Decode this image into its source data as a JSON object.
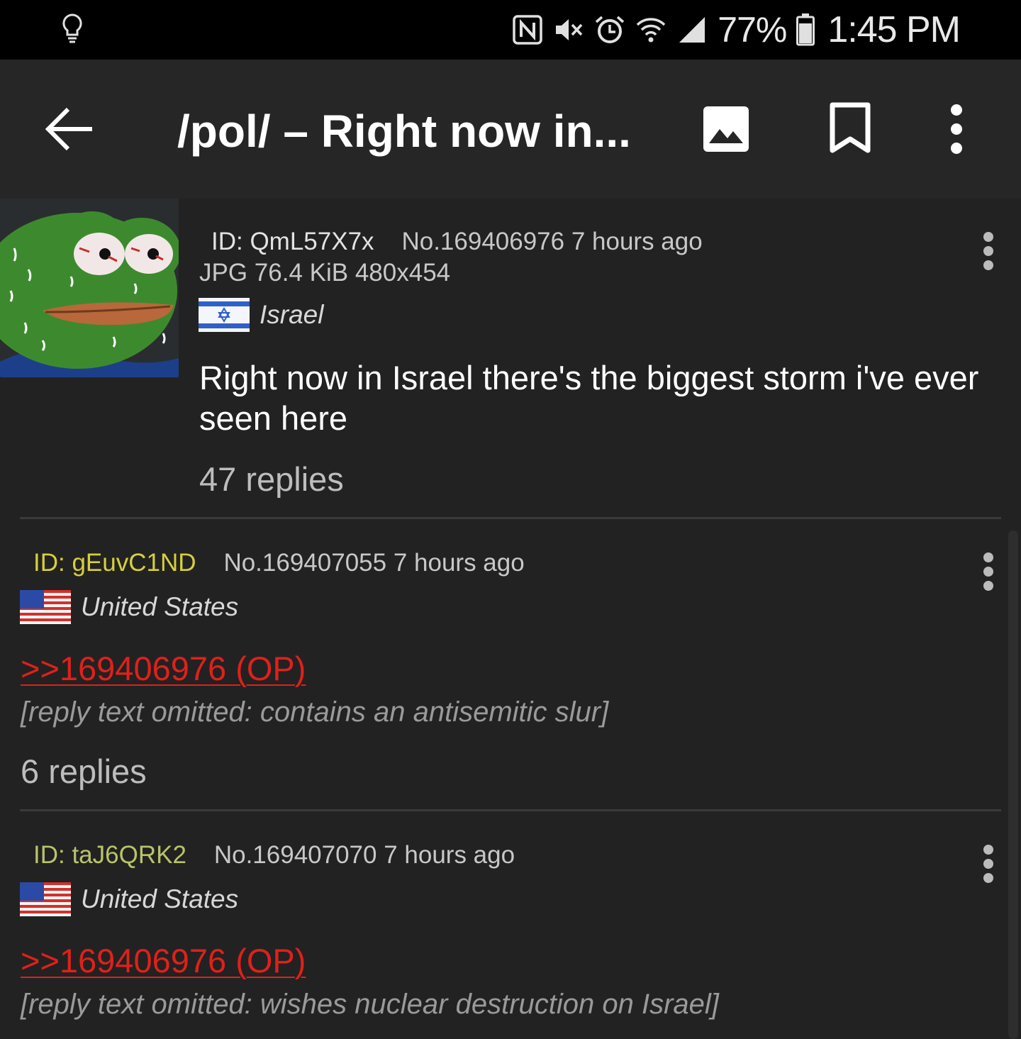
{
  "status_bar": {
    "battery_percent": "77%",
    "time": "1:45 PM",
    "icons": [
      "lightbulb-icon",
      "nfc-icon",
      "mute-icon",
      "alarm-icon",
      "wifi-icon",
      "signal-icon",
      "battery-icon"
    ]
  },
  "app_bar": {
    "title": "/pol/ – Right now in...",
    "icons": [
      "back-arrow-icon",
      "image-icon",
      "bookmark-icon",
      "more-vert-icon"
    ]
  },
  "colors": {
    "background": "#222222",
    "app_bar": "#262626",
    "quote_link": "#e0201a",
    "id_yellow": "#d6cf3c",
    "id_olive": "#b8c46a"
  },
  "posts": [
    {
      "id_label": "ID: QmL57X7x",
      "number": "No.169406976",
      "time": "7 hours ago",
      "file_info": "JPG 76.4 KiB 480x454",
      "country": "Israel",
      "body": "Right now in Israel there's the biggest storm i've ever seen here",
      "replies": "47 replies"
    },
    {
      "id_label": "ID: gEuvC1ND",
      "number": "No.169407055",
      "time": "7 hours ago",
      "country": "United States",
      "quote": ">>169406976 (OP)",
      "body_omitted": "[reply text omitted: contains an antisemitic slur]",
      "replies": "6 replies"
    },
    {
      "id_label": "ID: taJ6QRK2",
      "number": "No.169407070",
      "time": "7 hours ago",
      "country": "United States",
      "quote": ">>169406976 (OP)",
      "body_omitted": "[reply text omitted: wishes nuclear destruction on Israel]"
    }
  ]
}
